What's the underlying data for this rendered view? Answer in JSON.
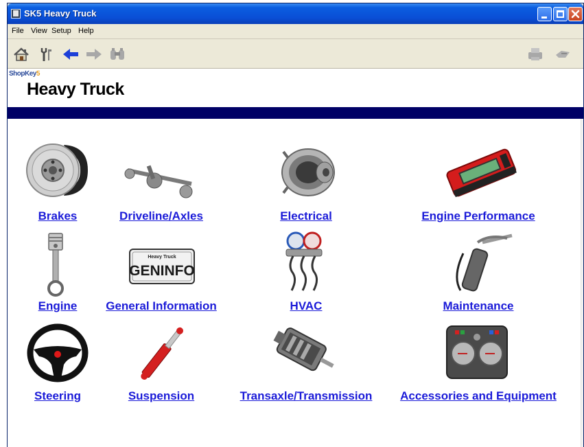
{
  "window": {
    "title": "SK5 Heavy Truck"
  },
  "menu": [
    "File",
    "View",
    "Setup",
    "Help"
  ],
  "toolbar": {
    "left": [
      "home-icon",
      "wrench-icon",
      "back-arrow-icon",
      "forward-arrow-icon",
      "binoculars-icon"
    ],
    "right": [
      "print-icon",
      "send-icon"
    ]
  },
  "banner": {
    "brand_prefix": "ShopKey",
    "brand_suffix": "5",
    "product": "Heavy Truck"
  },
  "categories": [
    {
      "label": "Brakes",
      "icon": "brake-rotor-icon"
    },
    {
      "label": "Driveline/Axles",
      "icon": "axle-icon"
    },
    {
      "label": "Electrical",
      "icon": "alternator-icon"
    },
    {
      "label": "Engine Performance",
      "icon": "scan-tool-icon"
    },
    {
      "label": "Engine",
      "icon": "piston-icon"
    },
    {
      "label": "General Information",
      "icon": "geninfo-plate-icon"
    },
    {
      "label": "HVAC",
      "icon": "ac-gauge-icon"
    },
    {
      "label": "Maintenance",
      "icon": "grease-gun-icon"
    },
    {
      "label": "Steering",
      "icon": "steering-wheel-icon"
    },
    {
      "label": "Suspension",
      "icon": "shock-absorber-icon"
    },
    {
      "label": "Transaxle/Transmission",
      "icon": "transmission-icon"
    },
    {
      "label": "Accessories and Equipment",
      "icon": "dashboard-controls-icon"
    }
  ],
  "plate": {
    "top": "Heavy Truck",
    "main": "GENINFO"
  },
  "colors": {
    "link": "#1a1ad8",
    "titlebar": "#0a4fd6",
    "navy_bar": "#000066"
  }
}
